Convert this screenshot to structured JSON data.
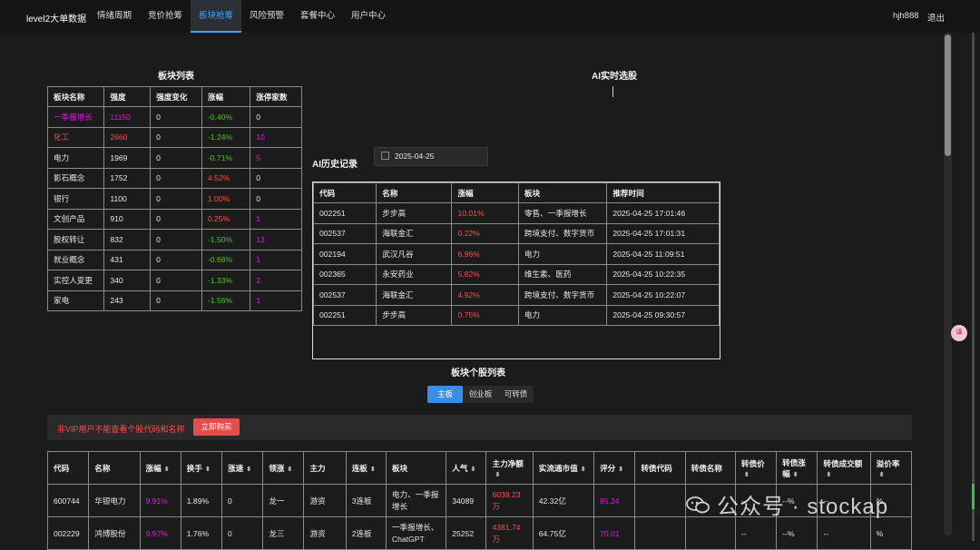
{
  "nav": {
    "brand": "level2大单数据",
    "items": [
      "情绪周期",
      "竞价抢筹",
      "板块抢筹",
      "风险预警",
      "套餐中心",
      "用户中心"
    ],
    "active_index": 2,
    "username": "hjh888",
    "logout": "退出"
  },
  "sector_list": {
    "title": "板块列表",
    "headers": [
      "板块名称",
      "强度",
      "强度变化",
      "涨幅",
      "涨停家数"
    ],
    "rows": [
      {
        "name": "一季报增长",
        "strength": "11150",
        "change": "0",
        "pct": "-0.40%",
        "limit": "0",
        "name_color": "magenta",
        "strength_color": "magenta",
        "pct_color": "green",
        "limit_color": "white"
      },
      {
        "name": "化工",
        "strength": "2660",
        "change": "0",
        "pct": "-1.24%",
        "limit": "10",
        "name_color": "red",
        "strength_color": "red",
        "pct_color": "green",
        "limit_color": "magenta"
      },
      {
        "name": "电力",
        "strength": "1969",
        "change": "0",
        "pct": "-0.71%",
        "limit": "5",
        "name_color": "white",
        "strength_color": "white",
        "pct_color": "green",
        "limit_color": "magenta"
      },
      {
        "name": "影石概念",
        "strength": "1752",
        "change": "0",
        "pct": "4.52%",
        "limit": "0",
        "name_color": "white",
        "strength_color": "white",
        "pct_color": "red",
        "limit_color": "white"
      },
      {
        "name": "银行",
        "strength": "1100",
        "change": "0",
        "pct": "1.00%",
        "limit": "0",
        "name_color": "white",
        "strength_color": "white",
        "pct_color": "red",
        "limit_color": "white"
      },
      {
        "name": "文创产品",
        "strength": "910",
        "change": "0",
        "pct": "0.25%",
        "limit": "1",
        "name_color": "white",
        "strength_color": "white",
        "pct_color": "red",
        "limit_color": "magenta"
      },
      {
        "name": "股权转让",
        "strength": "832",
        "change": "0",
        "pct": "-1.50%",
        "limit": "13",
        "name_color": "white",
        "strength_color": "white",
        "pct_color": "green",
        "limit_color": "magenta"
      },
      {
        "name": "就业概念",
        "strength": "431",
        "change": "0",
        "pct": "-0.68%",
        "limit": "1",
        "name_color": "white",
        "strength_color": "white",
        "pct_color": "green",
        "limit_color": "magenta"
      },
      {
        "name": "实控人变更",
        "strength": "340",
        "change": "0",
        "pct": "-1.33%",
        "limit": "2",
        "name_color": "white",
        "strength_color": "white",
        "pct_color": "green",
        "limit_color": "magenta"
      },
      {
        "name": "家电",
        "strength": "243",
        "change": "0",
        "pct": "-1.56%",
        "limit": "1",
        "name_color": "white",
        "strength_color": "white",
        "pct_color": "green",
        "limit_color": "magenta"
      }
    ]
  },
  "ai_realtime": {
    "title": "AI实时选股"
  },
  "ai_history": {
    "title": "AI历史记录",
    "date": "2025-04-25",
    "headers": [
      "代码",
      "名称",
      "涨幅",
      "板块",
      "推荐时间"
    ],
    "rows": [
      {
        "code": "002251",
        "name": "步步高",
        "pct": "10.01%",
        "sector": "零售、一季报增长",
        "time": "2025-04-25 17:01:46"
      },
      {
        "code": "002537",
        "name": "海联金汇",
        "pct": "0.22%",
        "sector": "跨境支付、数字货币",
        "time": "2025-04-25 17:01:31"
      },
      {
        "code": "002194",
        "name": "武汉凡谷",
        "pct": "6.96%",
        "sector": "电力",
        "time": "2025-04-25 11:09:51"
      },
      {
        "code": "002365",
        "name": "永安药业",
        "pct": "5.82%",
        "sector": "维生素、医药",
        "time": "2025-04-25 10:22:35"
      },
      {
        "code": "002537",
        "name": "海联金汇",
        "pct": "4.92%",
        "sector": "跨境支付、数字货币",
        "time": "2025-04-25 10:22:07"
      },
      {
        "code": "002251",
        "name": "步步高",
        "pct": "0.75%",
        "sector": "电力",
        "time": "2025-04-25 09:30:57"
      }
    ]
  },
  "stock_list": {
    "title": "板块个股列表",
    "tabs": [
      "主板",
      "创业板",
      "可转债"
    ],
    "active_tab": 0,
    "vip_notice": "非VIP用户不能查看个股代码和名称",
    "buy_label": "立即购买",
    "headers": [
      "代码",
      "名称",
      "涨幅",
      "换手",
      "涨速",
      "领涨",
      "主力",
      "连板",
      "板块",
      "人气",
      "主力净额",
      "实流通市值",
      "评分",
      "转债代码",
      "转债名称",
      "转债价",
      "转债涨幅",
      "转债成交额",
      "溢价率"
    ],
    "sortable": [
      false,
      false,
      true,
      true,
      true,
      true,
      false,
      true,
      false,
      true,
      true,
      true,
      true,
      false,
      false,
      true,
      true,
      true,
      true
    ],
    "rows": [
      {
        "code": "600744",
        "name": "华银电力",
        "pct": "9.91%",
        "turnover": "1.89%",
        "speed": "0",
        "lead": "龙一",
        "main": "游资",
        "board": "3连板",
        "sector": "电力、一季报增长",
        "pop": "34089",
        "net": "6039.23万",
        "cap": "42.32亿",
        "score": "85.24",
        "cb_code": "",
        "cb_name": "",
        "cb_price": "--",
        "cb_pct": "--%",
        "cb_amount": "--",
        "premium": "%"
      },
      {
        "code": "002229",
        "name": "鸿博股份",
        "pct": "9.97%",
        "turnover": "1.76%",
        "speed": "0",
        "lead": "龙三",
        "main": "游资",
        "board": "2连板",
        "sector": "一季报增长、ChatGPT",
        "pop": "25252",
        "net": "4381.74万",
        "cap": "64.75亿",
        "score": "70.01",
        "cb_code": "",
        "cb_name": "",
        "cb_price": "--",
        "cb_pct": "--%",
        "cb_amount": "--",
        "premium": "%"
      }
    ]
  },
  "watermark": "公众号 · stockap",
  "float_badge": "译",
  "colors": {
    "red": "#ff4d4f",
    "green": "#52c41a",
    "magenta": "#e01bd6",
    "accent": "#3ea6ff",
    "button_red": "#e74c4c"
  }
}
